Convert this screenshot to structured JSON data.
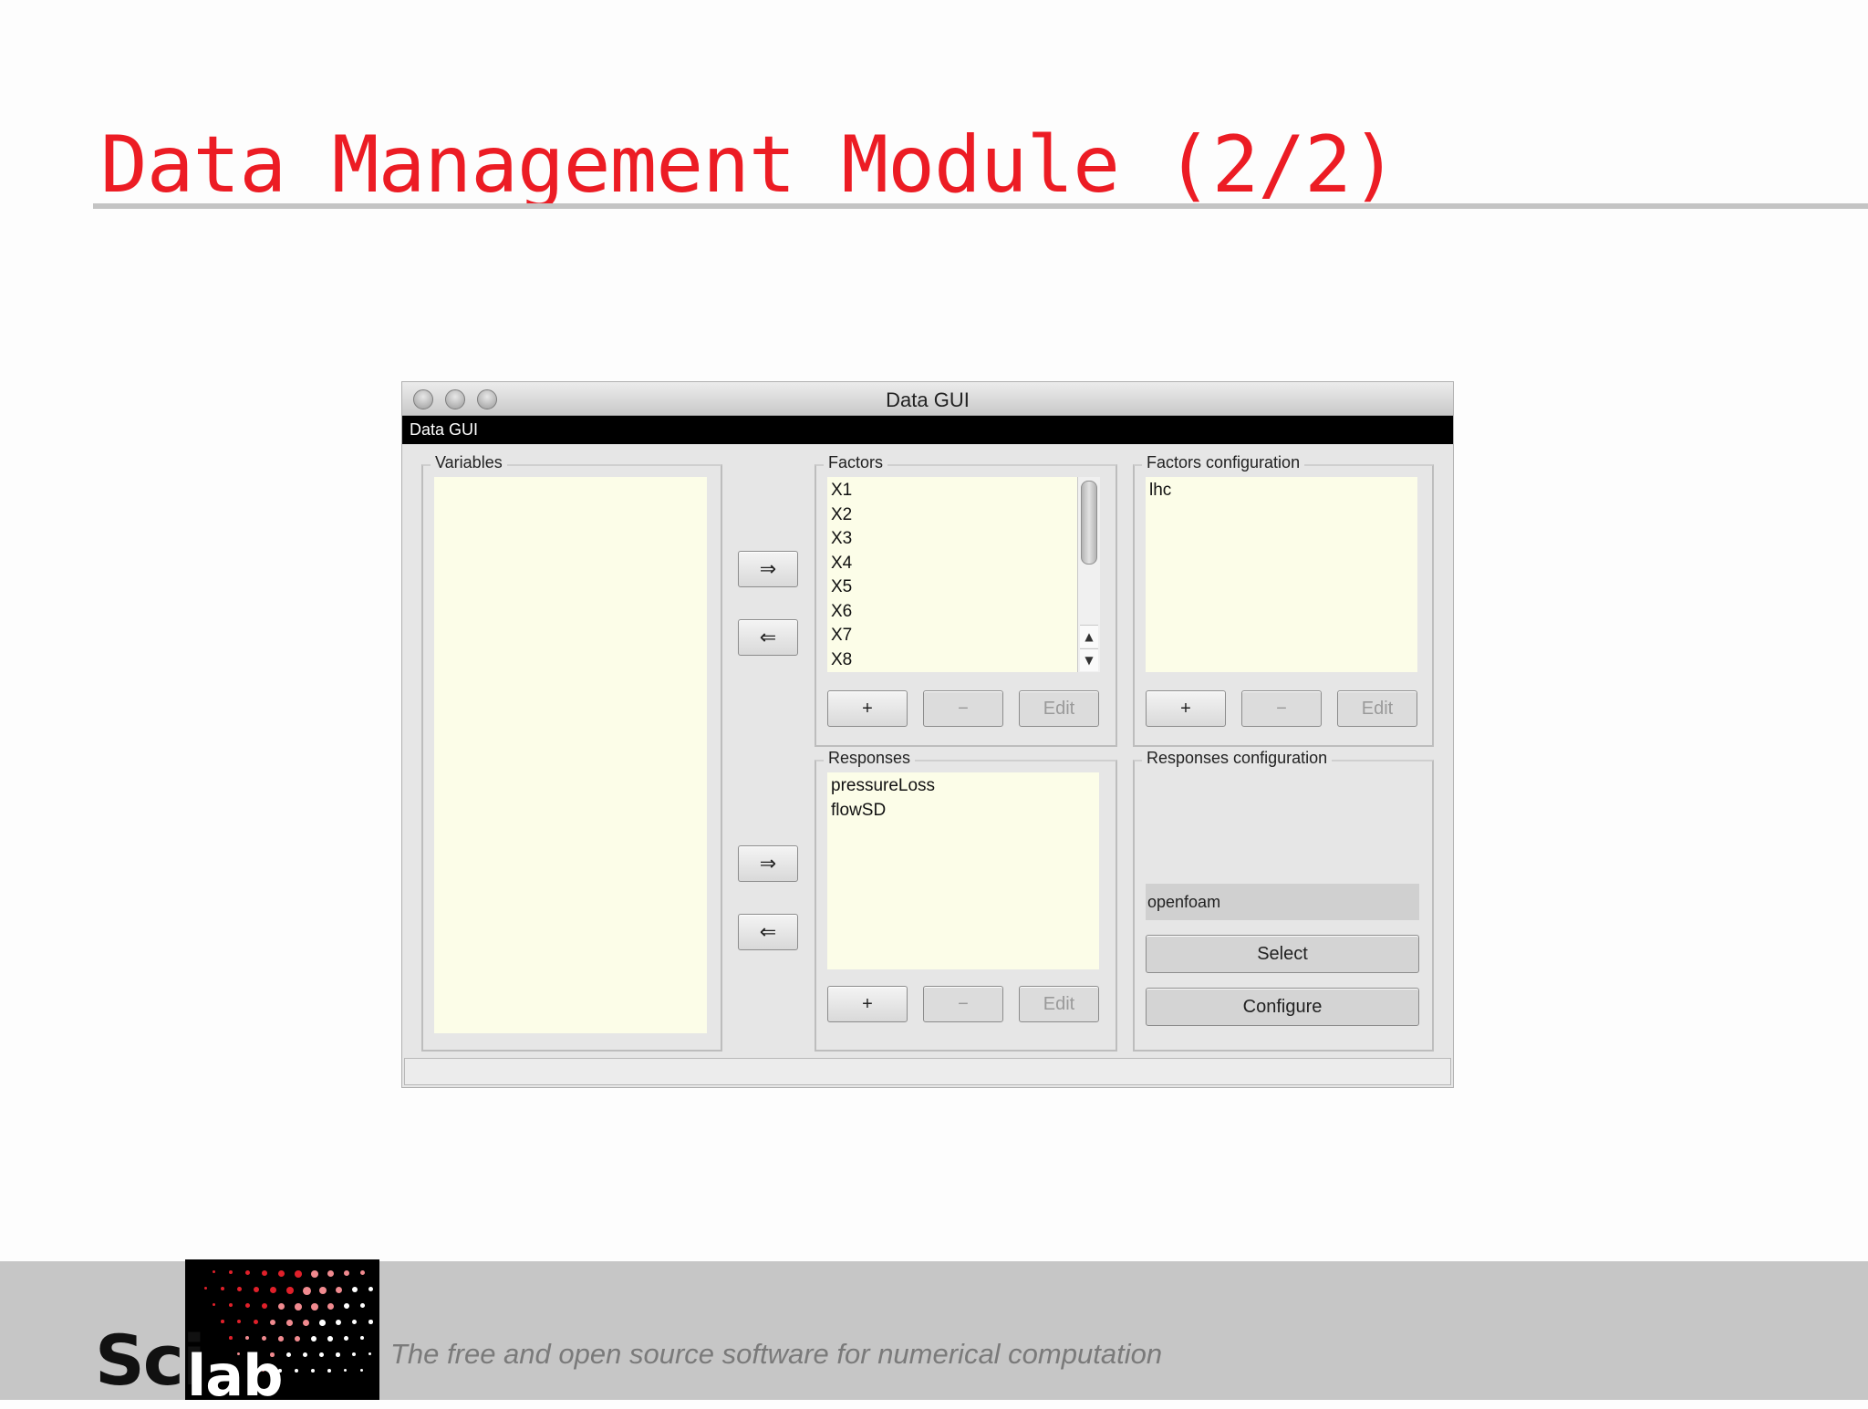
{
  "slide": {
    "title": "Data Management Module (2/2)",
    "tagline": "The free and open source software for numerical computation",
    "logo": {
      "sci": "Sci",
      "lab": "lab"
    }
  },
  "window": {
    "title": "Data GUI",
    "menu_label": "Data GUI"
  },
  "variables": {
    "legend": "Variables",
    "items": []
  },
  "arrows": {
    "add": "⇒",
    "remove": "⇐"
  },
  "factors": {
    "legend": "Factors",
    "items": [
      "X1",
      "X2",
      "X3",
      "X4",
      "X5",
      "X6",
      "X7",
      "X8"
    ],
    "add_label": "+",
    "remove_label": "−",
    "edit_label": "Edit"
  },
  "factors_configuration": {
    "legend": "Factors configuration",
    "items": [
      "lhc"
    ],
    "add_label": "+",
    "remove_label": "−",
    "edit_label": "Edit"
  },
  "responses": {
    "legend": "Responses",
    "items": [
      "pressureLoss",
      "flowSD"
    ],
    "add_label": "+",
    "remove_label": "−",
    "edit_label": "Edit"
  },
  "responses_configuration": {
    "legend": "Responses configuration",
    "solver_value": "openfoam",
    "select_label": "Select",
    "configure_label": "Configure"
  },
  "colors": {
    "title": "#ec1c24",
    "list_bg": "#fcfde8",
    "footer": "#c6c6c6"
  }
}
